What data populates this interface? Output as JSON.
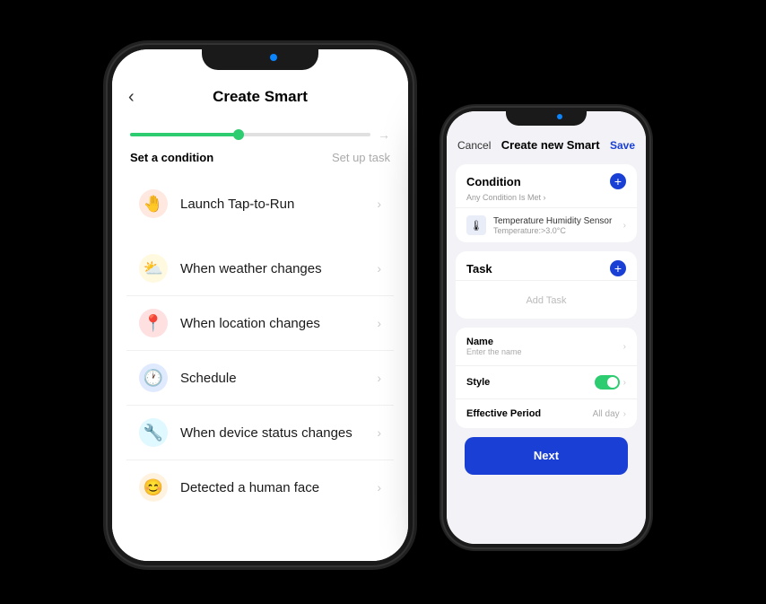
{
  "phone_left": {
    "header": {
      "back": "‹",
      "title": "Create Smart"
    },
    "steps": {
      "left": "Set a condition",
      "right": "Set up task"
    },
    "menu_items": [
      {
        "id": "tap-to-run",
        "icon": "🤚",
        "icon_bg": "#ffe8e0",
        "label": "Launch Tap-to-Run"
      },
      {
        "id": "weather",
        "icon": "⛅",
        "icon_bg": "#fff9e0",
        "label": "When weather changes"
      },
      {
        "id": "location",
        "icon": "📍",
        "icon_bg": "#ffe0e0",
        "label": "When location changes"
      },
      {
        "id": "schedule",
        "icon": "🕐",
        "icon_bg": "#e0eaff",
        "label": "Schedule"
      },
      {
        "id": "device-status",
        "icon": "🔧",
        "icon_bg": "#e0f8ff",
        "label": "When device status changes"
      },
      {
        "id": "human-face",
        "icon": "😊",
        "icon_bg": "#fff3e0",
        "label": "Detected a human face"
      }
    ]
  },
  "phone_right": {
    "header": {
      "cancel": "Cancel",
      "title": "Create new Smart",
      "save": "Save"
    },
    "condition_section": {
      "title": "Condition",
      "subtitle": "Any Condition Is Met ›",
      "plus": "+",
      "item": {
        "icon": "🌡",
        "name": "Temperature Humidity Sensor",
        "value": "Temperature:>3.0°C"
      }
    },
    "task_section": {
      "title": "Task",
      "plus": "+",
      "add_task": "Add Task"
    },
    "form": {
      "name_label": "Name",
      "name_placeholder": "Enter the name",
      "style_label": "Style",
      "effective_label": "Effective Period",
      "effective_value": "All day"
    },
    "bottom_button": "Next"
  }
}
